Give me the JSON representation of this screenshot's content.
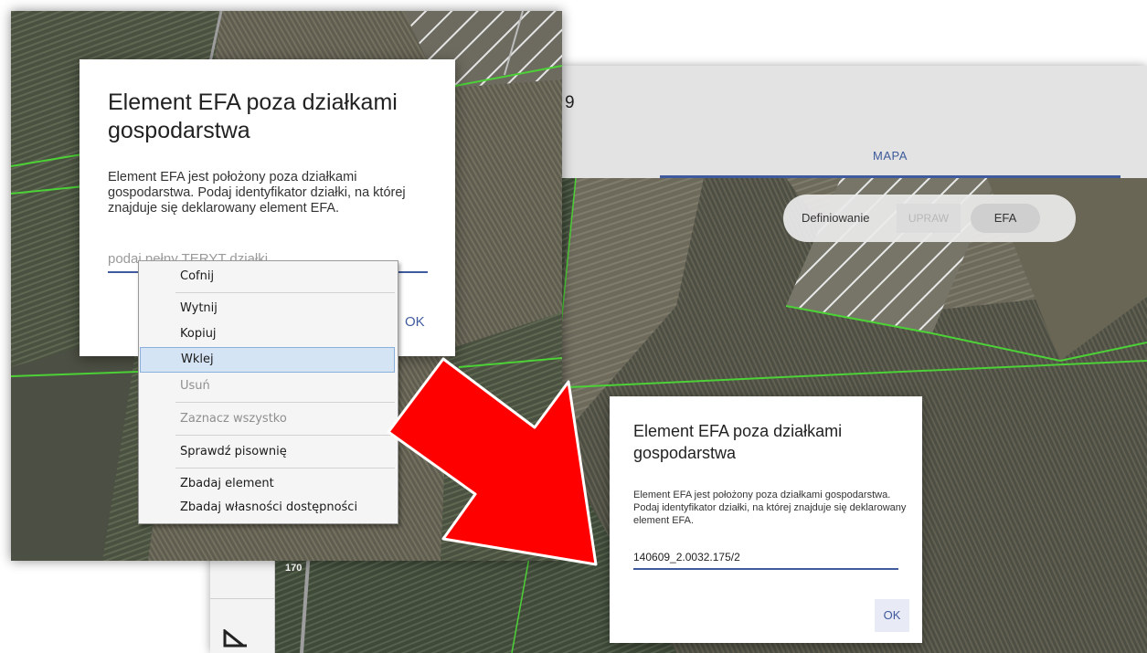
{
  "back_window": {
    "title_fragment": "9",
    "tab_label": "MAPA",
    "toggle": {
      "label": "Definiowanie",
      "option_uprawy": "UPRAW",
      "option_efa": "EFA"
    },
    "map_label": "170",
    "dialog": {
      "title": "Element EFA poza działkami gospodarstwa",
      "body": "Element EFA jest położony poza działkami gospodarstwa. Podaj identyfikator działki, na której znajduje się deklarowany element EFA.",
      "input_value": "140609_2.0032.175/2",
      "ok_label": "OK"
    }
  },
  "front_window": {
    "dialog": {
      "title": "Element EFA poza działkami gospodarstwa",
      "body": "Element EFA jest położony poza działkami gospodarstwa. Podaj identyfikator działki, na której znajduje się deklarowany element EFA.",
      "input_placeholder": "podaj pełny TERYT działki",
      "ok_label": "OK"
    },
    "context_menu": {
      "items": [
        {
          "label": "Cofnij",
          "enabled": true
        },
        {
          "label": "Wytnij",
          "enabled": true
        },
        {
          "label": "Kopiuj",
          "enabled": true
        },
        {
          "label": "Wklej",
          "enabled": true,
          "highlighted": true
        },
        {
          "label": "Usuń",
          "enabled": false
        },
        {
          "label": "Zaznacz wszystko",
          "enabled": false
        },
        {
          "label": "Sprawdź pisownię",
          "enabled": true
        },
        {
          "label": "Zbadaj element",
          "enabled": true
        },
        {
          "label": "Zbadaj własności dostępności",
          "enabled": true
        }
      ]
    }
  },
  "colors": {
    "accent": "#3f5a9d",
    "arrow": "#ff0000",
    "parcel_outline": "#4cd137",
    "menu_highlight": "#d5e4f4"
  }
}
